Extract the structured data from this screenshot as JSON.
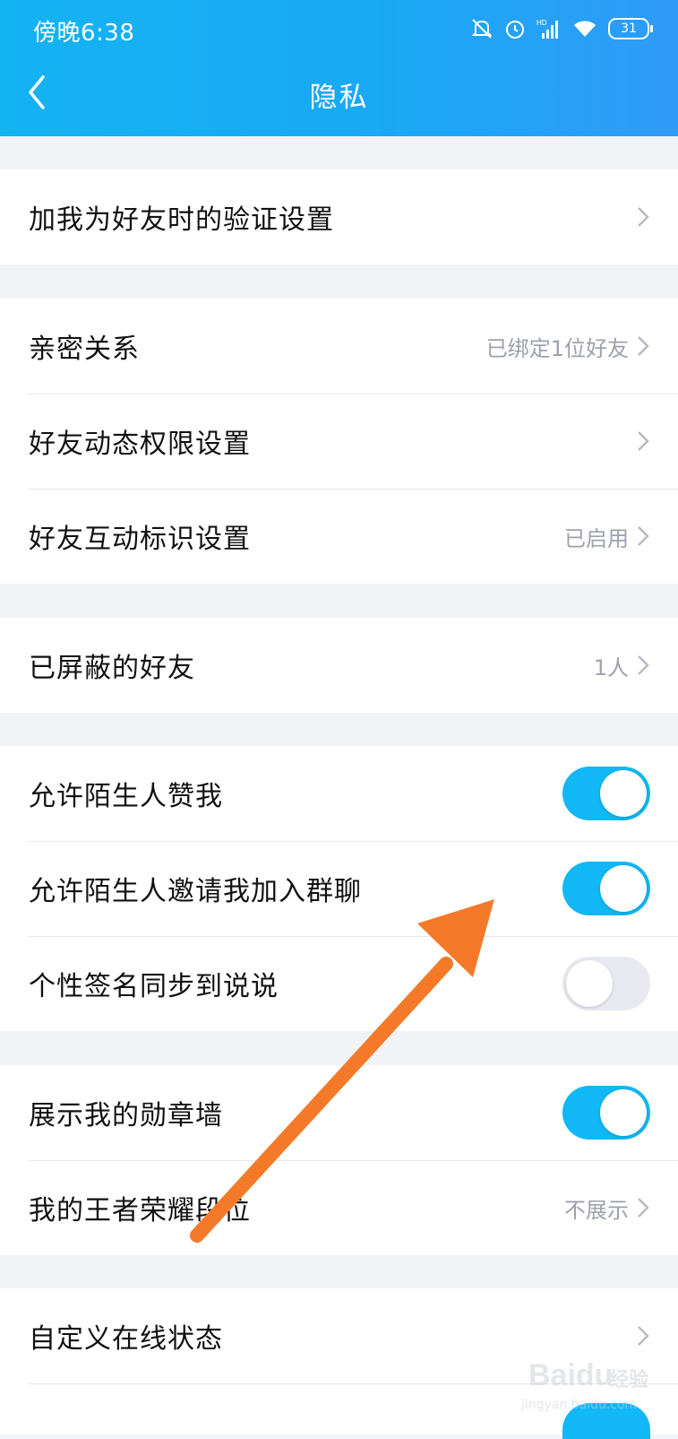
{
  "status_bar": {
    "time": "傍晚6:38",
    "battery": "31",
    "signal_badge": "HD"
  },
  "header": {
    "title": "隐私"
  },
  "groups": [
    {
      "rows": [
        {
          "label": "加我为好友时的验证设置",
          "value": "",
          "type": "chevron"
        }
      ]
    },
    {
      "rows": [
        {
          "label": "亲密关系",
          "value": "已绑定1位好友",
          "type": "chevron"
        },
        {
          "label": "好友动态权限设置",
          "value": "",
          "type": "chevron"
        },
        {
          "label": "好友互动标识设置",
          "value": "已启用",
          "type": "chevron"
        }
      ]
    },
    {
      "rows": [
        {
          "label": "已屏蔽的好友",
          "value": "1人",
          "type": "chevron"
        }
      ]
    },
    {
      "rows": [
        {
          "label": "允许陌生人赞我",
          "type": "toggle",
          "checked": true
        },
        {
          "label": "允许陌生人邀请我加入群聊",
          "type": "toggle",
          "checked": true
        },
        {
          "label": "个性签名同步到说说",
          "type": "toggle",
          "checked": false
        }
      ]
    },
    {
      "rows": [
        {
          "label": "展示我的勋章墙",
          "type": "toggle",
          "checked": true
        },
        {
          "label": "我的王者荣耀段位",
          "value": "不展示",
          "type": "chevron"
        }
      ]
    },
    {
      "rows": [
        {
          "label": "自定义在线状态",
          "value": "",
          "type": "chevron"
        }
      ]
    }
  ],
  "colors": {
    "accent": "#12b7f5",
    "annotation_arrow": "#f47a2a",
    "background": "#f2f3f7"
  },
  "icons": [
    "back-icon",
    "mute-icon",
    "alarm-icon",
    "signal-icon",
    "wifi-icon",
    "battery-icon",
    "chevron-right-icon"
  ],
  "watermark": {
    "text": "Baidu",
    "sub": "jingyan.baidu.com",
    "mark": "经验"
  }
}
